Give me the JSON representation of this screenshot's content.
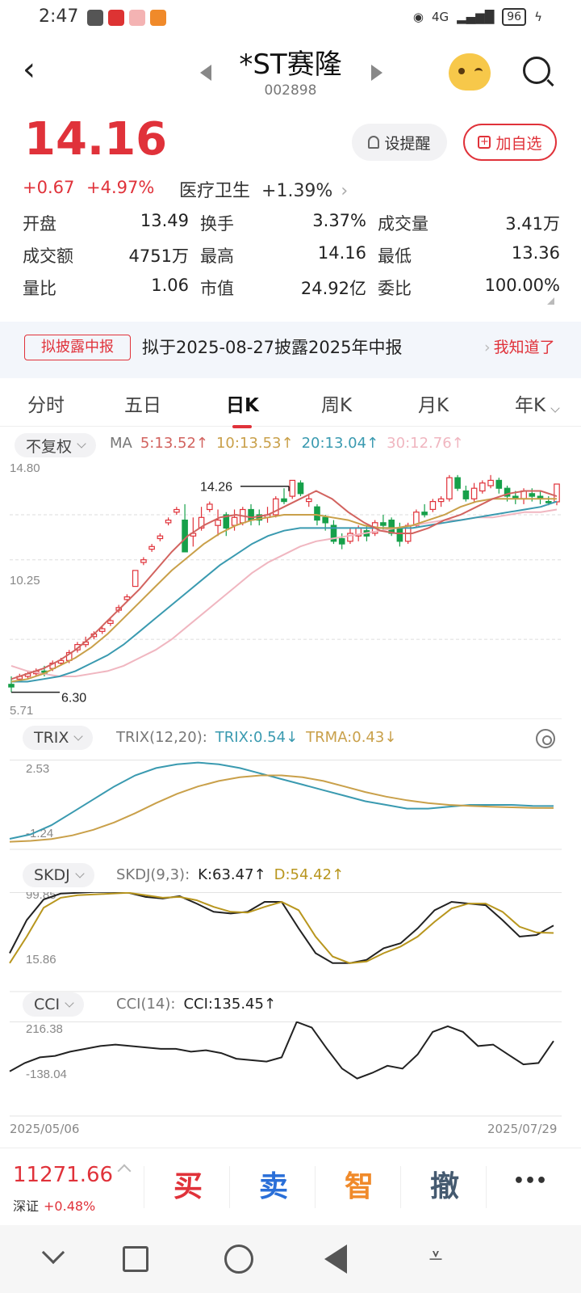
{
  "status": {
    "time": "2:47",
    "network": "4G",
    "battery": "96"
  },
  "header": {
    "title": "*ST赛隆",
    "code": "002898"
  },
  "quote": {
    "price": "14.16",
    "change": "+0.67",
    "change_pct": "+4.97%",
    "sector": "医疗卫生",
    "sector_pct": "+1.39%",
    "alert_label": "设提醒",
    "fav_label": "加自选"
  },
  "stats": [
    [
      {
        "label": "开盘",
        "value": "13.49",
        "color": ""
      },
      {
        "label": "换手",
        "value": "3.37%",
        "color": ""
      },
      {
        "label": "成交量",
        "value": "3.41万",
        "color": ""
      }
    ],
    [
      {
        "label": "成交额",
        "value": "4751万",
        "color": ""
      },
      {
        "label": "最高",
        "value": "14.16",
        "color": "red"
      },
      {
        "label": "最低",
        "value": "13.36",
        "color": "green"
      }
    ],
    [
      {
        "label": "量比",
        "value": "1.06",
        "color": ""
      },
      {
        "label": "市值",
        "value": "24.92亿",
        "color": ""
      },
      {
        "label": "委比",
        "value": "100.00%",
        "color": "red"
      }
    ]
  ],
  "notice": {
    "tag": "拟披露中报",
    "text": "拟于2025-08-27披露2025年中报",
    "button": "我知道了"
  },
  "tabs": [
    "分时",
    "五日",
    "日K",
    "周K",
    "月K",
    "年K"
  ],
  "active_tab": 2,
  "ma": {
    "adjust": "不复权",
    "label": "MA",
    "items": [
      {
        "text": "5:13.52↑",
        "color": "#d2635f"
      },
      {
        "text": "10:13.53↑",
        "color": "#c9a04a"
      },
      {
        "text": "20:13.04↑",
        "color": "#3a9ab0"
      },
      {
        "text": "30:12.76↑",
        "color": "#f0b6c0"
      }
    ]
  },
  "colors": {
    "up": "#e0323a",
    "down": "#16a04a",
    "ma5": "#d2635f",
    "ma10": "#c9a04a",
    "ma20": "#3a9ab0",
    "ma30": "#f0b6c0",
    "trix": "#3a9ab0",
    "trma": "#c9a04a"
  },
  "chart_data": [
    {
      "type": "candlestick",
      "y_labels": [
        "14.80",
        "10.25",
        "5.71"
      ],
      "ylim": [
        5.71,
        14.8
      ],
      "annotations": [
        {
          "text": "14.26",
          "value": 14.26
        },
        {
          "text": "6.30",
          "value": 6.3
        }
      ],
      "candles": [
        [
          6.6,
          6.5,
          6.9,
          6.3
        ],
        [
          6.8,
          6.9,
          7.0,
          6.7
        ],
        [
          6.9,
          7.0,
          7.1,
          6.8
        ],
        [
          7.0,
          7.1,
          7.2,
          6.9
        ],
        [
          7.1,
          7.0,
          7.3,
          6.9
        ],
        [
          7.2,
          7.4,
          7.5,
          7.1
        ],
        [
          7.4,
          7.5,
          7.6,
          7.3
        ],
        [
          7.5,
          7.8,
          7.9,
          7.4
        ],
        [
          7.9,
          8.1,
          8.2,
          7.8
        ],
        [
          8.1,
          8.2,
          8.4,
          8.0
        ],
        [
          8.4,
          8.5,
          8.6,
          8.3
        ],
        [
          8.6,
          8.7,
          8.8,
          8.5
        ],
        [
          8.9,
          9.0,
          9.1,
          8.8
        ],
        [
          9.4,
          9.5,
          9.6,
          9.3
        ],
        [
          9.8,
          9.9,
          10.0,
          9.7
        ],
        [
          10.3,
          10.9,
          10.9,
          10.3
        ],
        [
          11.2,
          11.3,
          11.4,
          11.1
        ],
        [
          11.7,
          11.8,
          11.9,
          11.6
        ],
        [
          12.1,
          12.2,
          12.3,
          12.0
        ],
        [
          12.7,
          12.8,
          12.9,
          12.6
        ],
        [
          13.1,
          13.2,
          13.3,
          13.0
        ],
        [
          12.8,
          11.6,
          13.4,
          11.6
        ],
        [
          12.2,
          12.3,
          12.9,
          11.8
        ],
        [
          12.5,
          12.9,
          13.3,
          12.4
        ],
        [
          13.2,
          13.4,
          13.5,
          13.1
        ],
        [
          12.6,
          12.8,
          13.2,
          12.2
        ],
        [
          13.0,
          12.5,
          13.1,
          12.2
        ],
        [
          12.6,
          12.9,
          13.2,
          12.4
        ],
        [
          12.7,
          13.2,
          13.3,
          12.6
        ],
        [
          13.2,
          12.8,
          13.4,
          12.6
        ],
        [
          13.0,
          12.8,
          13.2,
          12.6
        ],
        [
          12.9,
          13.0,
          13.3,
          12.7
        ],
        [
          13.0,
          13.6,
          13.7,
          12.9
        ],
        [
          13.6,
          13.5,
          14.0,
          13.4
        ],
        [
          13.7,
          14.3,
          14.3,
          13.6
        ],
        [
          14.2,
          13.8,
          14.3,
          13.7
        ],
        [
          13.5,
          13.6,
          13.8,
          13.3
        ],
        [
          13.3,
          12.8,
          13.4,
          12.6
        ],
        [
          12.9,
          12.7,
          13.0,
          12.4
        ],
        [
          12.6,
          12.0,
          12.8,
          11.9
        ],
        [
          12.1,
          11.9,
          12.3,
          11.7
        ],
        [
          12.0,
          12.3,
          12.5,
          11.9
        ],
        [
          12.2,
          12.5,
          12.6,
          12.0
        ],
        [
          12.4,
          12.2,
          12.6,
          12.0
        ],
        [
          12.3,
          12.7,
          12.8,
          12.2
        ],
        [
          12.7,
          12.6,
          13.0,
          12.4
        ],
        [
          12.8,
          12.3,
          12.9,
          12.2
        ],
        [
          12.5,
          12.0,
          12.7,
          11.8
        ],
        [
          12.0,
          12.6,
          12.7,
          11.9
        ],
        [
          12.6,
          13.1,
          13.2,
          12.5
        ],
        [
          13.1,
          13.0,
          13.4,
          12.9
        ],
        [
          13.2,
          13.5,
          13.6,
          13.1
        ],
        [
          13.5,
          13.6,
          13.7,
          13.3
        ],
        [
          13.6,
          14.4,
          14.5,
          13.5
        ],
        [
          14.4,
          14.0,
          14.5,
          13.9
        ],
        [
          13.9,
          13.6,
          14.1,
          13.5
        ],
        [
          13.6,
          14.0,
          14.2,
          13.5
        ],
        [
          13.9,
          14.2,
          14.3,
          13.8
        ],
        [
          14.1,
          14.3,
          14.5,
          14.0
        ],
        [
          14.3,
          14.0,
          14.4,
          13.8
        ],
        [
          14.0,
          13.7,
          14.1,
          13.5
        ],
        [
          13.7,
          13.6,
          13.9,
          13.4
        ],
        [
          13.6,
          13.9,
          14.0,
          13.4
        ],
        [
          13.8,
          13.7,
          14.0,
          13.5
        ],
        [
          13.7,
          13.6,
          13.9,
          13.4
        ],
        [
          13.5,
          13.49,
          13.7,
          13.36
        ],
        [
          13.49,
          14.16,
          14.16,
          13.36
        ]
      ],
      "ma5": [
        6.8,
        7.0,
        7.2,
        7.5,
        7.9,
        8.4,
        9.0,
        9.6,
        10.2,
        10.9,
        11.6,
        12.2,
        12.6,
        12.9,
        13.0,
        12.9,
        13.0,
        13.3,
        13.6,
        13.9,
        13.6,
        13.1,
        12.7,
        12.4,
        12.3,
        12.3,
        12.5,
        12.8,
        13.0,
        13.3,
        13.6,
        13.8,
        13.9,
        13.9,
        13.7
      ],
      "ma10": [
        6.7,
        6.8,
        7.0,
        7.3,
        7.6,
        8.0,
        8.5,
        9.1,
        9.7,
        10.3,
        10.9,
        11.4,
        11.9,
        12.3,
        12.6,
        12.8,
        12.9,
        13.0,
        13.0,
        13.0,
        12.9,
        12.8,
        12.6,
        12.5,
        12.5,
        12.6,
        12.8,
        13.0,
        13.3,
        13.5,
        13.6,
        13.6,
        13.6,
        13.6,
        13.6
      ],
      "ma20": [
        6.7,
        6.7,
        6.8,
        6.9,
        7.1,
        7.4,
        7.7,
        8.1,
        8.6,
        9.1,
        9.6,
        10.1,
        10.6,
        11.1,
        11.5,
        11.9,
        12.2,
        12.4,
        12.5,
        12.5,
        12.5,
        12.5,
        12.5,
        12.5,
        12.5,
        12.5,
        12.6,
        12.7,
        12.8,
        12.9,
        13.0,
        13.1,
        13.2,
        13.3,
        13.5
      ],
      "ma30": [
        7.3,
        7.1,
        7.0,
        6.9,
        6.9,
        7.0,
        7.1,
        7.3,
        7.6,
        7.9,
        8.3,
        8.8,
        9.3,
        9.8,
        10.3,
        10.8,
        11.2,
        11.5,
        11.8,
        12.0,
        12.1,
        12.2,
        12.3,
        12.4,
        12.5,
        12.6,
        12.7,
        12.8,
        12.8,
        12.9,
        12.9,
        13.0,
        13.1,
        13.1,
        13.2
      ]
    },
    {
      "type": "line",
      "name_label": "TRIX",
      "params": "TRIX(12,20):",
      "legend": [
        {
          "text": "TRIX:0.54↓",
          "color": "#3a9ab0"
        },
        {
          "text": "TRMA:0.43↓",
          "color": "#c9a04a"
        }
      ],
      "y_labels": [
        "2.53",
        "-1.24"
      ],
      "ylim": [
        -1.24,
        2.53
      ],
      "series": [
        {
          "name": "TRIX",
          "values": [
            -1.24,
            -1.0,
            -0.5,
            0.2,
            0.9,
            1.6,
            2.2,
            2.6,
            2.8,
            2.9,
            2.8,
            2.6,
            2.3,
            2.0,
            1.7,
            1.4,
            1.1,
            0.8,
            0.6,
            0.4,
            0.4,
            0.5,
            0.6,
            0.6,
            0.6,
            0.55,
            0.54
          ]
        },
        {
          "name": "TRMA",
          "values": [
            -1.4,
            -1.35,
            -1.25,
            -1.05,
            -0.75,
            -0.35,
            0.15,
            0.7,
            1.2,
            1.6,
            1.9,
            2.1,
            2.2,
            2.2,
            2.1,
            1.9,
            1.6,
            1.3,
            1.05,
            0.85,
            0.7,
            0.6,
            0.55,
            0.5,
            0.47,
            0.44,
            0.43
          ]
        }
      ]
    },
    {
      "type": "line",
      "name_label": "SKDJ",
      "params": "SKDJ(9,3):",
      "legend": [
        {
          "text": "K:63.47↑",
          "color": "#222"
        },
        {
          "text": "D:54.42↑",
          "color": "#b8961e"
        }
      ],
      "y_labels": [
        "99.85",
        "15.86"
      ],
      "ylim": [
        15.86,
        99.85
      ],
      "series": [
        {
          "name": "K",
          "values": [
            30,
            70,
            95,
            102,
            103,
            104,
            104,
            103,
            98,
            96,
            99,
            90,
            80,
            78,
            80,
            92,
            92,
            60,
            30,
            18,
            18,
            22,
            36,
            42,
            60,
            82,
            92,
            90,
            88,
            70,
            50,
            52,
            63.47
          ]
        },
        {
          "name": "D",
          "values": [
            18,
            50,
            85,
            97,
            100,
            101,
            102,
            103,
            100,
            97,
            98,
            94,
            86,
            80,
            79,
            86,
            92,
            82,
            50,
            26,
            18,
            20,
            30,
            38,
            50,
            68,
            84,
            90,
            90,
            80,
            62,
            55,
            54.42
          ]
        }
      ]
    },
    {
      "type": "line",
      "name_label": "CCI",
      "params": "CCI(14):",
      "legend": [
        {
          "text": "CCI:135.45↑",
          "color": "#222"
        }
      ],
      "y_labels": [
        "216.38",
        "-138.04"
      ],
      "ylim": [
        -138.04,
        216.38
      ],
      "series": [
        {
          "name": "CCI",
          "values": [
            -80,
            -20,
            20,
            30,
            60,
            80,
            100,
            110,
            100,
            90,
            80,
            80,
            60,
            70,
            50,
            10,
            0,
            -10,
            20,
            270,
            230,
            80,
            -60,
            -130,
            -90,
            -40,
            -60,
            40,
            200,
            240,
            200,
            100,
            110,
            40,
            -30,
            -20,
            135.45
          ]
        }
      ],
      "x_labels": [
        "2025/05/06",
        "2025/07/29"
      ]
    }
  ],
  "bottom": {
    "index_value": "11271.66",
    "index_name": "深证",
    "index_pct": "+0.48%",
    "buy": "买",
    "sell": "卖",
    "smart": "智",
    "cancel": "撤",
    "more": "•••"
  }
}
